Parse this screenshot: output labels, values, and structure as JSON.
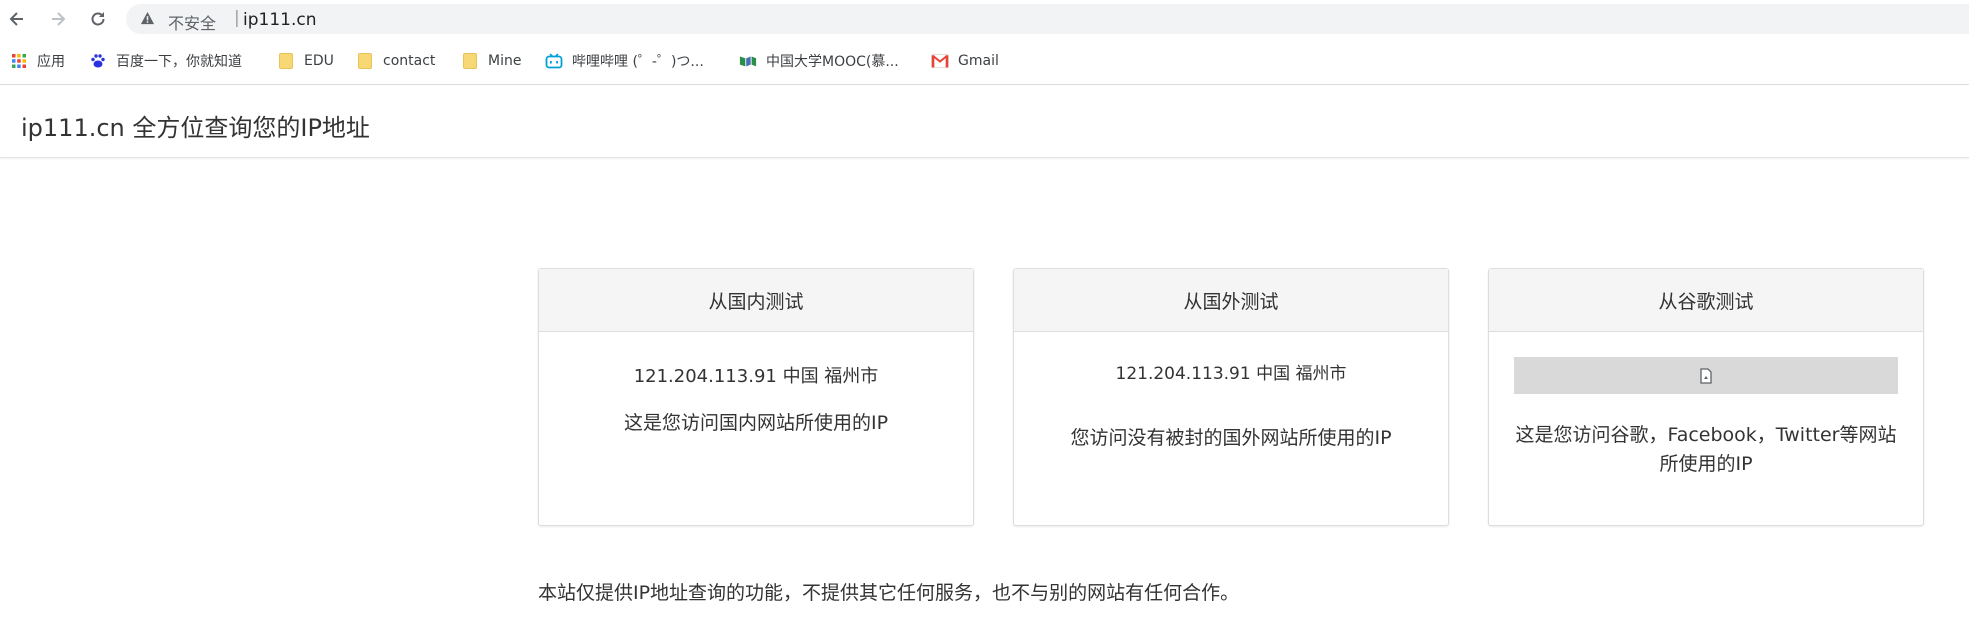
{
  "browser": {
    "security_label": "不安全",
    "separator": "|",
    "url": "ip111.cn",
    "bookmarks": [
      {
        "label": "应用",
        "icon": "apps-grid-icon"
      },
      {
        "label": "百度一下，你就知道",
        "icon": "baidu-paw-icon"
      },
      {
        "label": "EDU",
        "icon": "folder-icon"
      },
      {
        "label": "contact",
        "icon": "folder-icon"
      },
      {
        "label": "Mine",
        "icon": "folder-icon"
      },
      {
        "label": "哔哩哔哩 (゜-゜)つ...",
        "icon": "bilibili-icon"
      },
      {
        "label": "中国大学MOOC(慕...",
        "icon": "mooc-icon"
      },
      {
        "label": "Gmail",
        "icon": "gmail-icon"
      }
    ]
  },
  "site": {
    "title": "ip111.cn 全方位查询您的IP地址"
  },
  "cards": [
    {
      "title": "从国内测试",
      "ip": "121.204.113.91 中国 福州市",
      "description": "这是您访问国内网站所使用的IP"
    },
    {
      "title": "从国外测试",
      "ip": "121.204.113.91 中国 福州市",
      "description": "您访问没有被封的国外网站所使用的IP"
    },
    {
      "title": "从谷歌测试",
      "description_line1": "这是您访问谷歌，Facebook，Twitter等网站",
      "description_line2": "所使用的IP"
    }
  ],
  "footer": {
    "note": "本站仅提供IP地址查询的功能，不提供其它任何服务，也不与别的网站有任何合作。"
  },
  "colors": {
    "card_header_bg": "#f5f5f5",
    "omnibox_bg": "#f1f3f4",
    "frame_placeholder_bg": "#d9d9d9"
  }
}
